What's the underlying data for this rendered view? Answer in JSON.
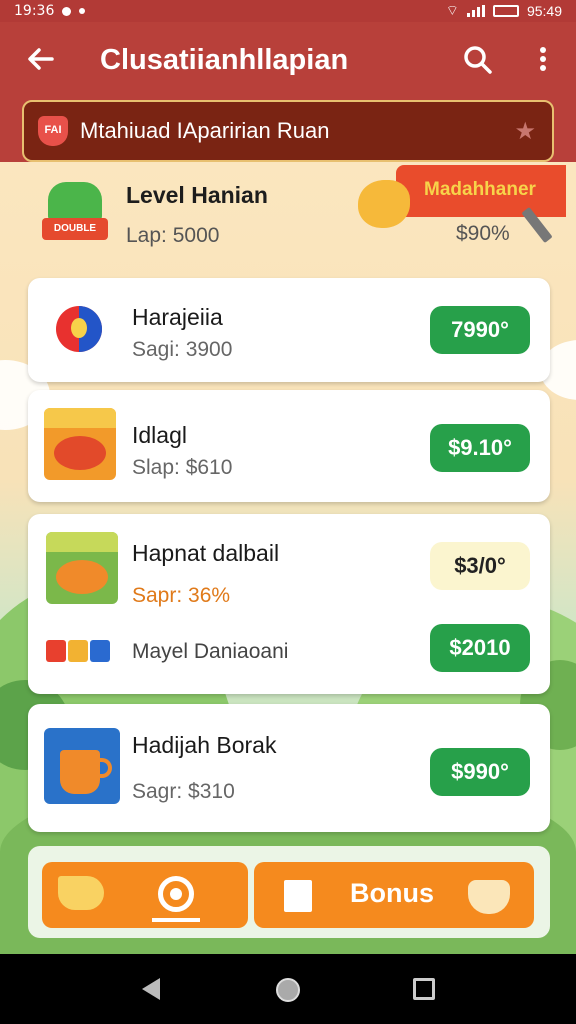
{
  "status_bar": {
    "time": "19:36",
    "clock_right": "95:49",
    "battery_label": ""
  },
  "app_bar": {
    "title": "Clusatiianhllapian",
    "back_icon": "arrow-left-icon",
    "search_icon": "search-icon",
    "menu_icon": "more-vert-icon"
  },
  "banner": {
    "text": "Mtahiuad IAparirian Ruan",
    "badge_text": "FAI"
  },
  "level": {
    "title": "Level Hanian",
    "subtitle": "Lap: 5000",
    "badge_text": "DOUBLE",
    "ribbon": "Madahhaner",
    "price": "$90%"
  },
  "items": [
    {
      "name": "Harajeiia",
      "sub": "Sagi: 3900",
      "price": "7990°"
    },
    {
      "name": "Idlagl",
      "sub": "Slap: $610",
      "price": "$9.10°"
    },
    {
      "name": "Hapnat dalbail",
      "sub": "Sapr: 36%",
      "price": "$3/0°",
      "extra_label": "Mayel Daniaoani",
      "extra_price": "$2010"
    },
    {
      "name": "Hadijah Borak",
      "sub": "Sagr: $310",
      "price": "$990°"
    }
  ],
  "bottom": {
    "bonus_label": "Bonus"
  },
  "colors": {
    "header": "#b8403a",
    "price_green": "#27a04a",
    "action_orange": "#f58a1e"
  }
}
